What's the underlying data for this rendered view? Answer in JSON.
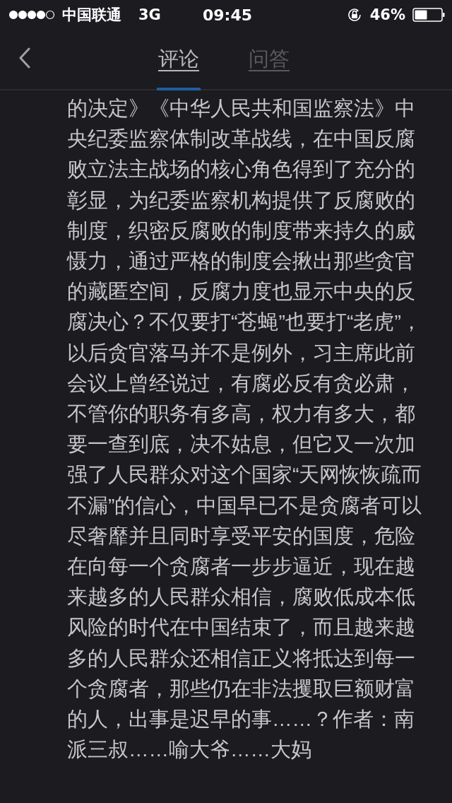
{
  "status_bar": {
    "carrier": "中国联通",
    "network": "3G",
    "time": "09:45",
    "battery": "46%"
  },
  "nav": {
    "back": true,
    "tabs": [
      {
        "label": "评论",
        "selected": true
      },
      {
        "label": "问答",
        "selected": false
      }
    ]
  },
  "article": {
    "text": "的决定》《中华人民共和国监察法》中央纪委监察体制改革战线，在中国反腐败立法主战场的核心角色得到了充分的彰显，为纪委监察机构提供了反腐败的制度，织密反腐败的制度带来持久的威慑力，通过严格的制度会揪出那些贪官的藏匿空间，反腐力度也显示中央的反腐决心？不仅要打“苍蝇”也要打“老虎”，以后贪官落马并不是例外，习主席此前会议上曾经说过，有腐必反有贪必肃，不管你的职务有多高，权力有多大，都要一查到底，决不姑息，但它又一次加强了人民群众对这个国家“天网恢恢疏而不漏”的信心，中国早已不是贪腐者可以尽奢靡并且同时享受平安的国度，危险在向每一个贪腐者一步步逼近，现在越来越多的人民群众相信，腐败低成本低风险的时代在中国结束了，而且越来越多的人民群众还相信正义将抵达到每一个贪腐者，那些仍在非法攫取巨额财富的人，出事是迟早的事……？作者：南派三叔……喻大爷……大妈"
  }
}
